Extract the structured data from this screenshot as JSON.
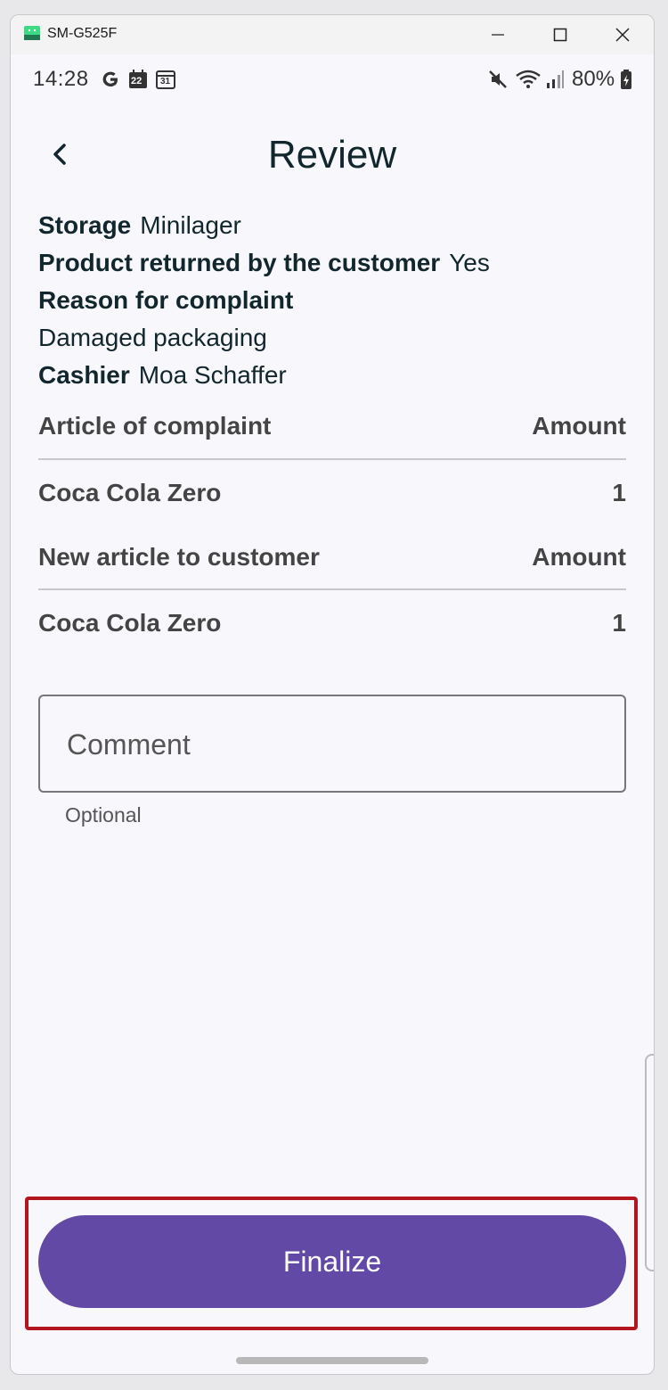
{
  "window": {
    "title": "SM-G525F"
  },
  "status_bar": {
    "time": "14:28",
    "calendar_day_1": "22",
    "calendar_day_2": "31",
    "battery": "80%"
  },
  "header": {
    "title": "Review"
  },
  "details": {
    "storage_label": "Storage",
    "storage_value": "Minilager",
    "returned_label": "Product returned by the customer",
    "returned_value": "Yes",
    "reason_label": "Reason for complaint",
    "reason_value": "Damaged packaging",
    "cashier_label": "Cashier",
    "cashier_value": "Moa Schaffer"
  },
  "complaint_table": {
    "col_article": "Article of complaint",
    "col_amount": "Amount",
    "rows": [
      {
        "article": "Coca Cola Zero",
        "amount": "1"
      }
    ]
  },
  "new_article_table": {
    "col_article": "New article to customer",
    "col_amount": "Amount",
    "rows": [
      {
        "article": "Coca Cola Zero",
        "amount": "1"
      }
    ]
  },
  "comment": {
    "placeholder": "Comment",
    "value": "",
    "helper": "Optional"
  },
  "actions": {
    "finalize_label": "Finalize"
  },
  "colors": {
    "primary": "#6249a5",
    "highlight": "#b3161f",
    "text": "#12262d"
  }
}
